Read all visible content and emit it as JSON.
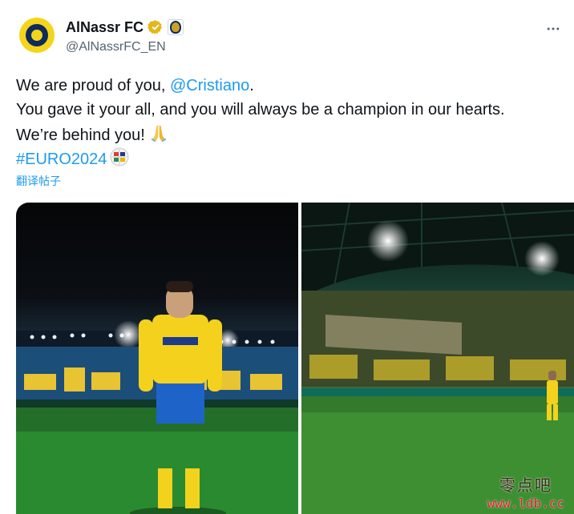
{
  "author": {
    "display_name": "AlNassr FC",
    "handle": "@AlNassrFC_EN",
    "avatar_icon": "al-nassr-crest",
    "verified_badge": "gold-verified-icon",
    "affiliation_badge": "al-nassr-crest-badge",
    "brand_colors": {
      "yellow": "#f4d51c",
      "navy": "#0f2a5c"
    }
  },
  "menu": {
    "icon": "more-icon"
  },
  "tweet": {
    "line1_prefix": "We are proud of you, ",
    "mention": "@Cristiano",
    "line1_suffix": ".",
    "line2": "You gave it your all, and you will always be a champion in our hearts.",
    "line3": "We’re behind you!",
    "line3_emoji": "folded-hands-icon",
    "hashtag": "#EURO2024",
    "hashtag_emoji": "euro2024-hashflag-icon"
  },
  "translate_label": "翻译帖子",
  "media": {
    "photos": [
      {
        "subject": "player-standing-photo"
      },
      {
        "subject": "stadium-crowd-photo"
      }
    ]
  },
  "watermark": {
    "cn": "零点吧",
    "url": "www.ldb.cc"
  },
  "colors": {
    "link": "#1d9bf0",
    "secondary_text": "#536471",
    "primary_text": "#0f1419"
  }
}
